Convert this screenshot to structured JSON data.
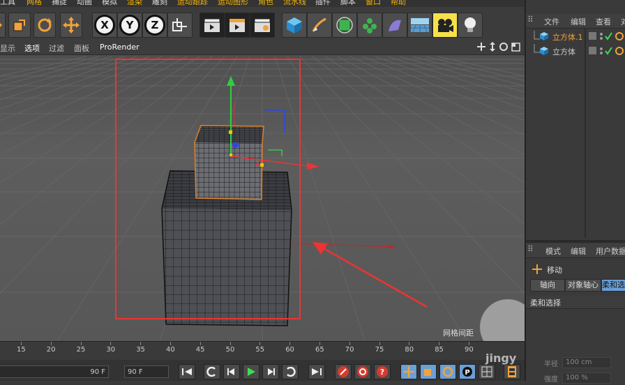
{
  "menu": {
    "items": [
      {
        "label": "工具",
        "highlight": false
      },
      {
        "label": "网格",
        "highlight": true
      },
      {
        "label": "捕捉",
        "highlight": false
      },
      {
        "label": "动画",
        "highlight": false
      },
      {
        "label": "模拟",
        "highlight": false
      },
      {
        "label": "渲染",
        "highlight": true
      },
      {
        "label": "雕刻",
        "highlight": false
      },
      {
        "label": "运动跟踪",
        "highlight": true
      },
      {
        "label": "运动图形",
        "highlight": true
      },
      {
        "label": "角色",
        "highlight": true
      },
      {
        "label": "流水线",
        "highlight": true
      },
      {
        "label": "插件",
        "highlight": false
      },
      {
        "label": "脚本",
        "highlight": false
      },
      {
        "label": "窗口",
        "highlight": true
      },
      {
        "label": "帮助",
        "highlight": true
      }
    ]
  },
  "toolbar": {
    "axis_x": "X",
    "axis_y": "Y",
    "axis_z": "Z"
  },
  "viewport_menu": {
    "items": [
      "显示",
      "选项",
      "过滤",
      "面板",
      "ProRender"
    ],
    "grid_spacing_label": "网格间距"
  },
  "timeline": {
    "ticks": [
      "15",
      "20",
      "25",
      "30",
      "35",
      "40",
      "45",
      "50",
      "55",
      "60",
      "65",
      "70",
      "75",
      "80",
      "85",
      "90"
    ]
  },
  "transport": {
    "start_frame": "90 F",
    "end_frame": "90 F"
  },
  "objects_panel": {
    "menu": [
      "文件",
      "编辑",
      "查看",
      "对"
    ],
    "objects": [
      {
        "name": "立方体.1",
        "selected": true
      },
      {
        "name": "立方体",
        "selected": false
      }
    ]
  },
  "attributes_panel": {
    "menu": [
      "模式",
      "编辑",
      "用户数据"
    ],
    "tool_name": "移动",
    "tabs": [
      "轴向",
      "对象轴心",
      "柔和选"
    ],
    "section": "柔和选择",
    "row1_label": "半径",
    "row1_value": "100 cm",
    "row2_label": "强度",
    "row2_value": "100 %"
  },
  "watermark": "jingy"
}
